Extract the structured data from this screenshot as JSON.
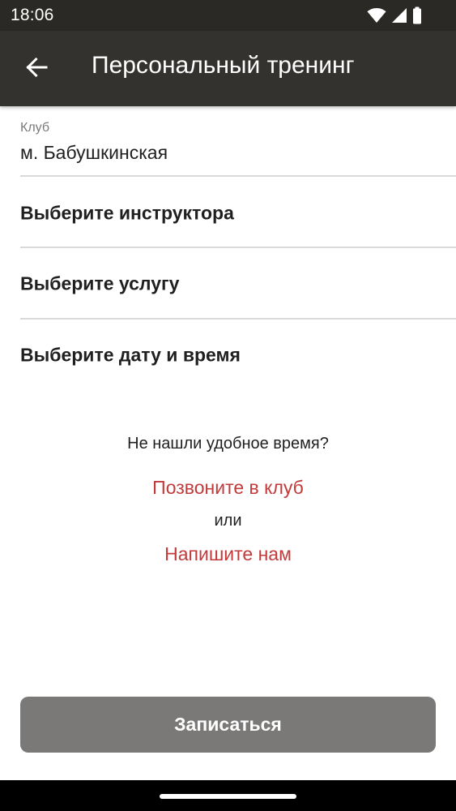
{
  "status_bar": {
    "time": "18:06",
    "icons": [
      "wifi-icon",
      "cellular-signal-icon",
      "battery-icon"
    ]
  },
  "app_bar": {
    "back_icon": "arrow-back-icon",
    "title": "Персональный тренинг"
  },
  "form": {
    "club": {
      "label": "Клуб",
      "value": "м. Бабушкинская"
    },
    "instructor_label": "Выберите инструктора",
    "service_label": "Выберите услугу",
    "datetime_label": "Выберите дату и время"
  },
  "help": {
    "question": "Не нашли удобное время?",
    "call_club": "Позвоните в клуб",
    "or": "или",
    "write_us": "Напишите нам"
  },
  "submit_label": "Записаться",
  "colors": {
    "status_bar": "#2b2926",
    "app_bar": "#34322f",
    "link": "#c23a3a",
    "button_disabled": "#7a7978"
  }
}
